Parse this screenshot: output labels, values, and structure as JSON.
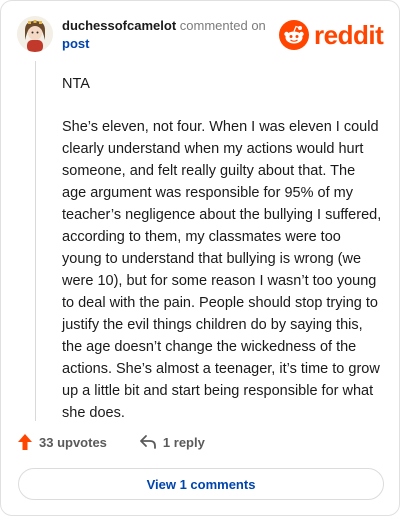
{
  "comment": {
    "username": "duchessofcamelot",
    "action": "commented on",
    "post_link": "post",
    "paragraphs": [
      "NTA",
      "She’s eleven, not four. When I was eleven I could clearly understand when my actions would hurt someone, and felt really guilty about that. The age argument was responsible for 95% of my teacher’s negligence about the bullying I suffered, according to them, my classmates were too young to understand that bullying is wrong (we were 10), but for some reason I wasn’t too young to deal with the pain. People should stop trying to justify the evil things children do by saying this, the age doesn’t change the wickedness of the actions. She’s almost a teenager, it’s time to grow up a little bit and start being responsible for what she does."
    ]
  },
  "brand": {
    "name": "reddit",
    "color": "#ff4500"
  },
  "footer": {
    "upvotes": "33 upvotes",
    "replies": "1 reply"
  },
  "view_button": "View 1 comments",
  "icons": {
    "upvote": "upvote-arrow-icon",
    "reply": "reply-arrow-icon",
    "logo": "reddit-snoo-icon"
  }
}
